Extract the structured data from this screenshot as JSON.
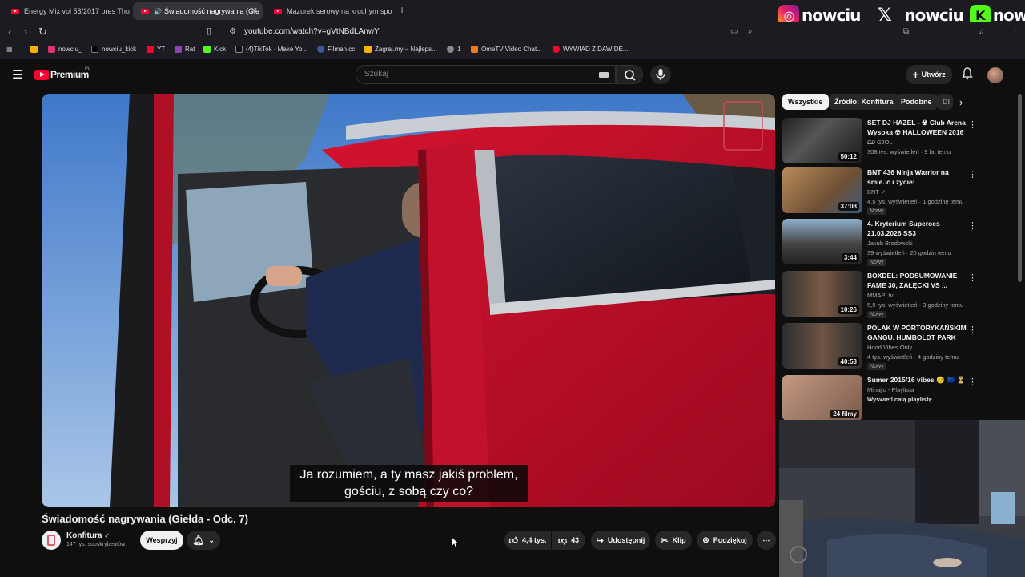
{
  "browser": {
    "tabs": [
      {
        "title": "Energy Mix vol 53/2017 pres Tho"
      },
      {
        "title": "Świadomość nagrywania (Gie"
      },
      {
        "title": "Mazurek serowy na kruchym spodzie"
      }
    ],
    "url": "youtube.com/watch?v=gVtNBdLAnwY",
    "bookmarks": [
      "nowciu_",
      "nowciu_kick",
      "YT",
      "Rat",
      "Kick",
      "(4)TikTok - Make Yo...",
      "Filman.cc",
      "Zagraj.my – Najleps...",
      "1",
      "OmeTV Video Chat...",
      "WYWIAD Z DAWIDE..."
    ]
  },
  "overlay": {
    "instagram": "nowciu_",
    "x": "_nowciu",
    "kick": "nowciu"
  },
  "youtube": {
    "logo_text": "Premium",
    "logo_suffix": "PL",
    "search_placeholder": "Szukaj",
    "create_label": "Utwórz"
  },
  "video": {
    "subtitle_line1": "Ja rozumiem, a ty masz jakiś problem,",
    "subtitle_line2": "gościu, z sobą czy co?",
    "title": "Świadomość nagrywania (Giełda - Odc. 7)",
    "channel": "Konfitura",
    "subscribers": "147 tys. subskrybentów",
    "support_label": "Wesprzyj",
    "likes": "4,4 tys.",
    "dislikes": "43",
    "share_label": "Udostępnij",
    "clip_label": "Klip",
    "thanks_label": "Podziękuj"
  },
  "sidebar": {
    "chips": [
      "Wszystkie",
      "Źródło: Konfitura",
      "Podobne",
      "Dl"
    ],
    "items": [
      {
        "title": "SET DJ HAZEL - ☢ Club Arena Wysoka ☢ HALLOWEEN 2016 ...",
        "channel": "G0 GJOL",
        "meta": "308 tys. wyświetleń · 9 lat temu",
        "duration": "50:12",
        "badge": ""
      },
      {
        "title": "BNT 436 Ninja Warrior na śmie..ć i życie!",
        "channel": "BNT ✓",
        "meta": "4,5 tys. wyświetleń · 1 godzinę temu",
        "duration": "37:08",
        "badge": "Nowy"
      },
      {
        "title": "4. Kryterium Superoes 21.03.2026 SS3",
        "channel": "Jakub Brodowski",
        "meta": "39 wyświetleń · 20 godzin temu",
        "duration": "3:44",
        "badge": "Nowy"
      },
      {
        "title": "BOXDEL: PODSUMOWANIE FAME 30, ZAŁĘCKI VS ...",
        "channel": "MMAPLtv",
        "meta": "5,9 tys. wyświetleń · 3 godziny temu",
        "duration": "10:26",
        "badge": "Nowy"
      },
      {
        "title": "POLAK W PORTORYKAŃSKIM GANGU. HUMBOLDT PARK",
        "channel": "Hood Vibes Only",
        "meta": "4 tys. wyświetleń · 4 godziny temu",
        "duration": "40:53",
        "badge": "Nowy"
      },
      {
        "title": "Sumer 2015/16 vibes 😊 🇪🇺 ⏳",
        "channel": "Mihajlo - Playlista",
        "meta": "Wyświetl całą playlistę",
        "duration": "24 filmy",
        "badge": ""
      }
    ]
  },
  "colors": {
    "yt_red": "#ff0033",
    "bg": "#0f0f0f",
    "car": "#c8102e",
    "kick_green": "#53fc18"
  }
}
